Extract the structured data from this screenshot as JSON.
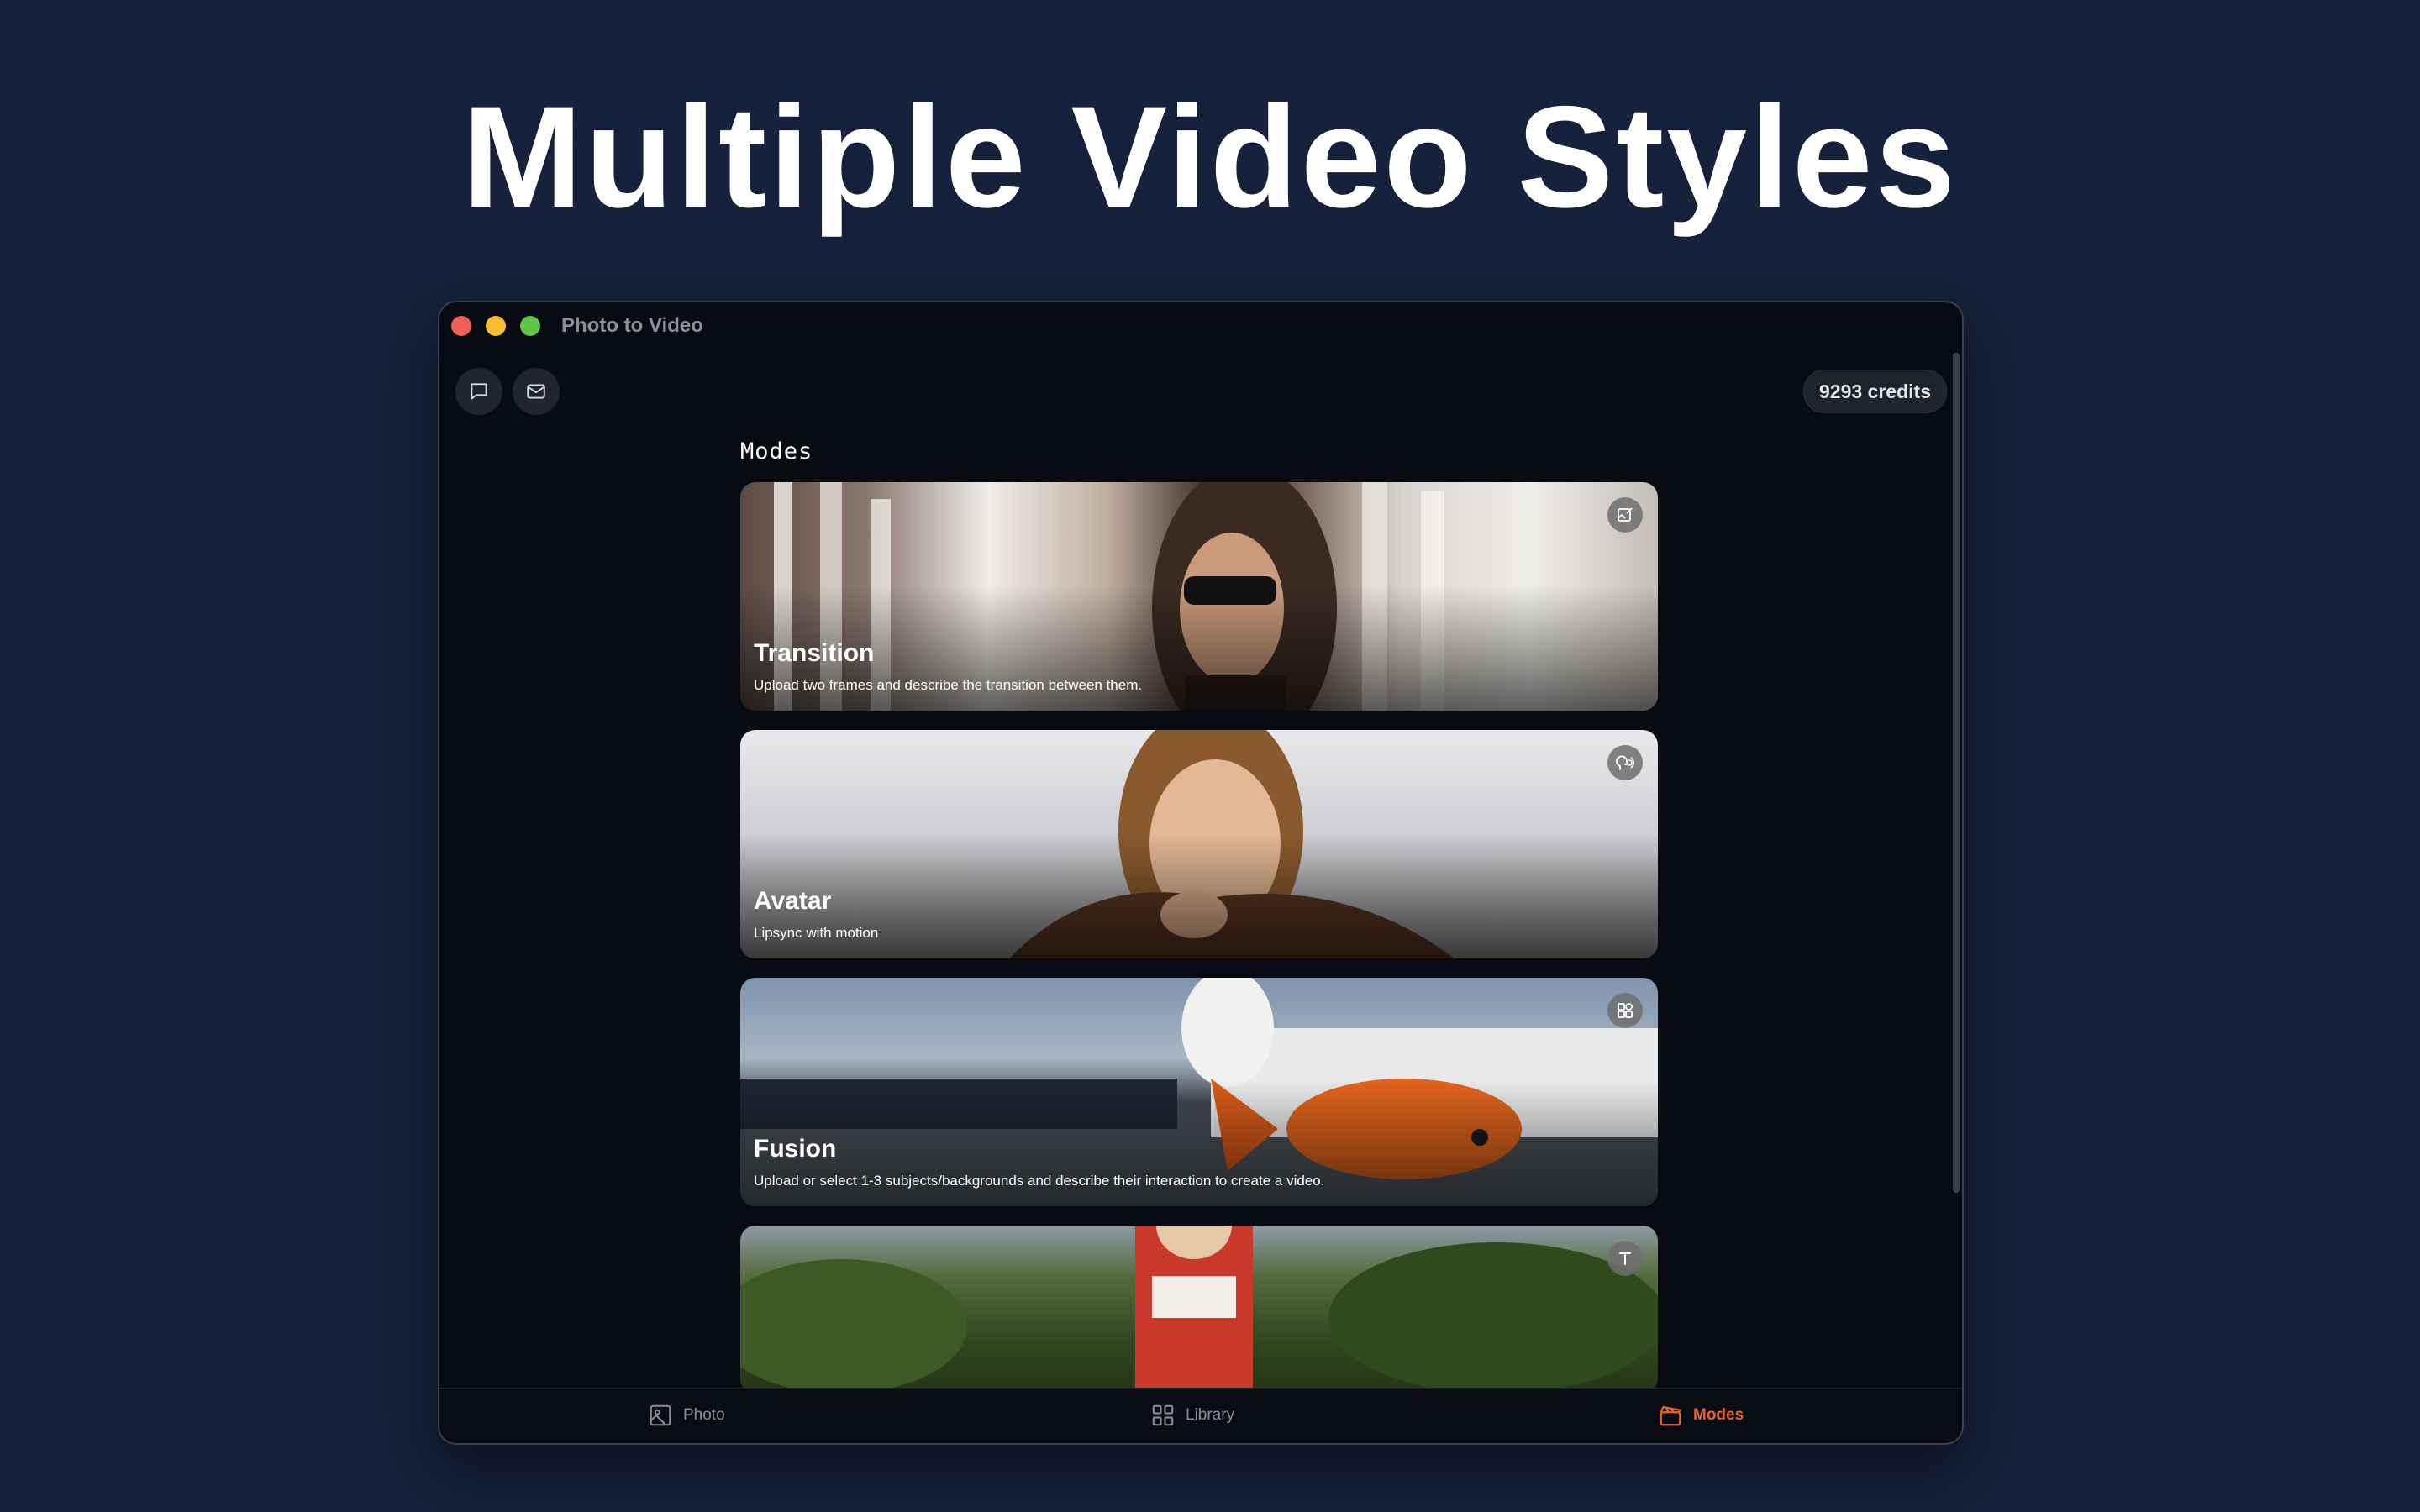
{
  "headline": "Multiple Video Styles",
  "window": {
    "title": "Photo to Video",
    "credits": "9293 credits",
    "toolbar": [
      {
        "icon": "chat-bubble-icon"
      },
      {
        "icon": "mail-icon"
      }
    ]
  },
  "main": {
    "section_label": "Modes",
    "modes": [
      {
        "title": "Transition",
        "description": "Upload two frames and describe the transition between them.",
        "icon": "image-edit-icon"
      },
      {
        "title": "Avatar",
        "description": "Lipsync with motion",
        "icon": "speaking-head-icon"
      },
      {
        "title": "Fusion",
        "description": "Upload or select 1-3 subjects/backgrounds and describe their interaction to create a video.",
        "icon": "shapes-icon"
      },
      {
        "title": "",
        "description": "",
        "icon": "text-icon"
      }
    ]
  },
  "tabs": [
    {
      "label": "Photo",
      "icon": "photo-icon",
      "active": false
    },
    {
      "label": "Library",
      "icon": "grid-icon",
      "active": false
    },
    {
      "label": "Modes",
      "icon": "clapperboard-icon",
      "active": true
    }
  ],
  "colors": {
    "page_background": "#16223b",
    "window_background": "#080b12",
    "accent": "#e8632a"
  }
}
